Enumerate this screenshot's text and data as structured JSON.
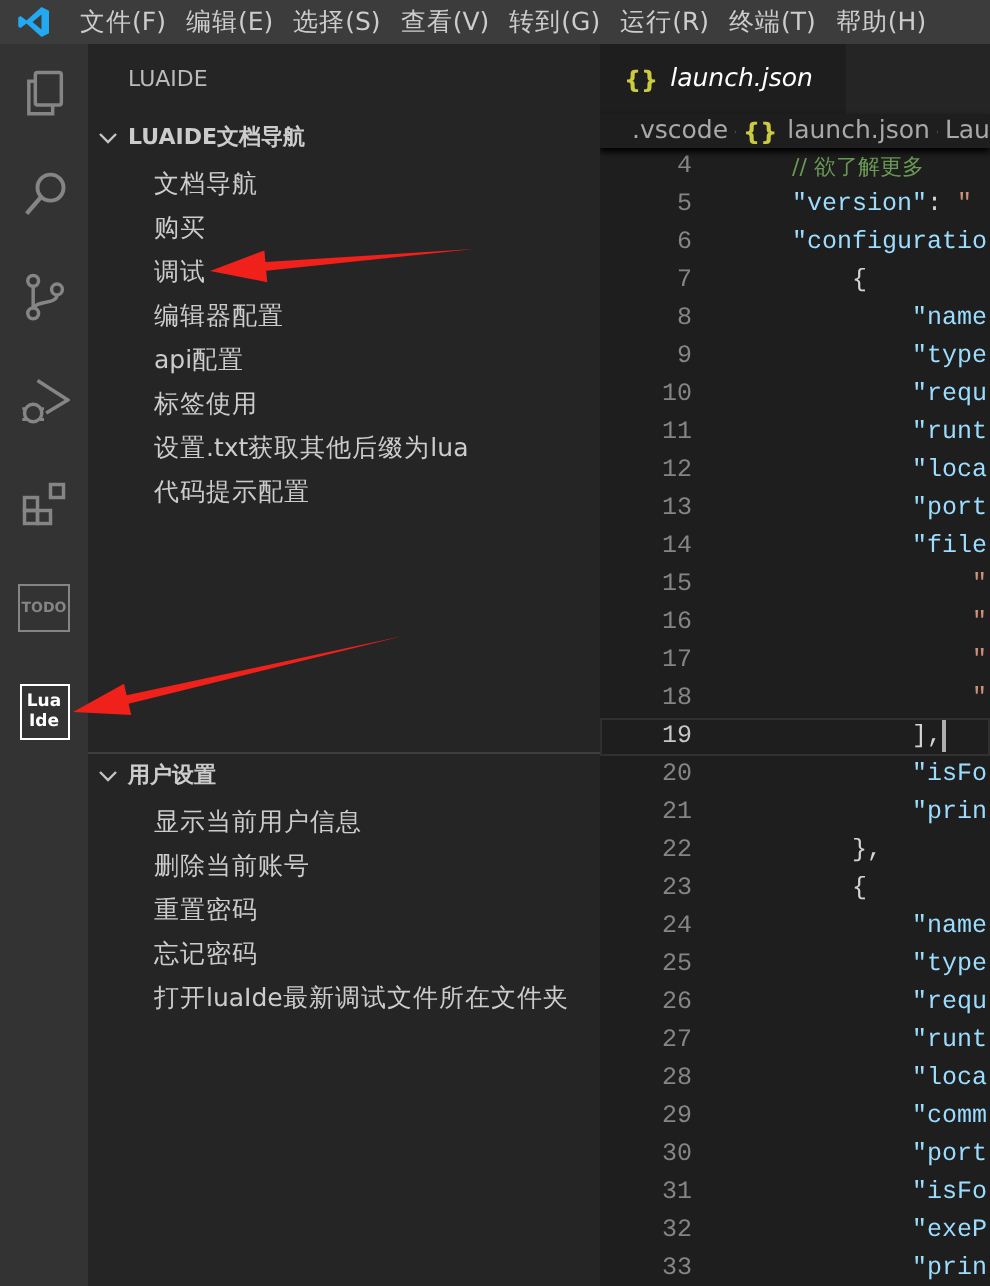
{
  "menu": [
    "文件(F)",
    "编辑(E)",
    "选择(S)",
    "查看(V)",
    "转到(G)",
    "运行(R)",
    "终端(T)",
    "帮助(H)"
  ],
  "activity_bar": [
    {
      "kind": "files",
      "selected": false,
      "marked": false
    },
    {
      "kind": "search",
      "selected": false,
      "marked": false
    },
    {
      "kind": "branch",
      "selected": false,
      "marked": false
    },
    {
      "kind": "run",
      "selected": false,
      "marked": false
    },
    {
      "kind": "blocks",
      "selected": false,
      "marked": false
    },
    {
      "kind": "todo",
      "label": "TODO",
      "selected": false,
      "marked": false
    },
    {
      "kind": "luaide",
      "label_lines": [
        "Lua",
        "Ide"
      ],
      "selected": true,
      "marked": true
    }
  ],
  "sidebar": {
    "title": "LUAIDE",
    "sections": [
      {
        "title": "LUAIDE文档导航",
        "expanded": true,
        "items": [
          {
            "label": "文档导航",
            "marked": false
          },
          {
            "label": "购买",
            "marked": false
          },
          {
            "label": "调试",
            "marked": true
          },
          {
            "label": "编辑器配置",
            "marked": false
          },
          {
            "label": "api配置",
            "marked": false
          },
          {
            "label": "标签使用",
            "marked": false
          },
          {
            "label": "设置.txt获取其他后缀为lua",
            "marked": false
          },
          {
            "label": "代码提示配置",
            "marked": false
          }
        ]
      },
      {
        "title": "用户设置",
        "expanded": true,
        "items": [
          {
            "label": "显示当前用户信息",
            "marked": false
          },
          {
            "label": "删除当前账号",
            "marked": false
          },
          {
            "label": "重置密码",
            "marked": false
          },
          {
            "label": "忘记密码",
            "marked": false
          },
          {
            "label": "打开luaIde最新调试文件所在文件夹",
            "marked": false
          }
        ]
      }
    ]
  },
  "editor": {
    "tabs": [
      {
        "icon_text": "{}",
        "label": "launch.json",
        "selected": true,
        "preview": true
      }
    ],
    "breadcrumbs": [
      {
        "label": ".vscode"
      },
      {
        "label": "launch.json",
        "icon_text": "{}"
      },
      {
        "label": "Lau"
      }
    ],
    "lines": [
      {
        "n": "4",
        "current": false,
        "text": "    // 欲了解更多"
      },
      {
        "n": "5",
        "current": false,
        "text": "    \"version\": \""
      },
      {
        "n": "6",
        "current": false,
        "text": "    \"configuratio"
      },
      {
        "n": "7",
        "current": false,
        "text": "        {"
      },
      {
        "n": "8",
        "current": false,
        "text": "            \"name"
      },
      {
        "n": "9",
        "current": false,
        "text": "            \"type"
      },
      {
        "n": "10",
        "current": false,
        "text": "            \"requ"
      },
      {
        "n": "11",
        "current": false,
        "text": "            \"runt"
      },
      {
        "n": "12",
        "current": false,
        "text": "            \"loca"
      },
      {
        "n": "13",
        "current": false,
        "text": "            \"port"
      },
      {
        "n": "14",
        "current": false,
        "text": "            \"file"
      },
      {
        "n": "15",
        "current": false,
        "text": "                \""
      },
      {
        "n": "16",
        "current": false,
        "text": "                \""
      },
      {
        "n": "17",
        "current": false,
        "text": "                \""
      },
      {
        "n": "18",
        "current": false,
        "text": "                \""
      },
      {
        "n": "19",
        "current": true,
        "text": "            ],"
      },
      {
        "n": "20",
        "current": false,
        "text": "            \"isFo"
      },
      {
        "n": "21",
        "current": false,
        "text": "            \"prin"
      },
      {
        "n": "22",
        "current": false,
        "text": "        },"
      },
      {
        "n": "23",
        "current": false,
        "text": "        {"
      },
      {
        "n": "24",
        "current": false,
        "text": "            \"name"
      },
      {
        "n": "25",
        "current": false,
        "text": "            \"type"
      },
      {
        "n": "26",
        "current": false,
        "text": "            \"requ"
      },
      {
        "n": "27",
        "current": false,
        "text": "            \"runt"
      },
      {
        "n": "28",
        "current": false,
        "text": "            \"loca"
      },
      {
        "n": "29",
        "current": false,
        "text": "            \"comm"
      },
      {
        "n": "30",
        "current": false,
        "text": "            \"port"
      },
      {
        "n": "31",
        "current": false,
        "text": "            \"isFo"
      },
      {
        "n": "32",
        "current": false,
        "text": "            \"exeP"
      },
      {
        "n": "33",
        "current": false,
        "text": "            \"prin"
      }
    ]
  }
}
